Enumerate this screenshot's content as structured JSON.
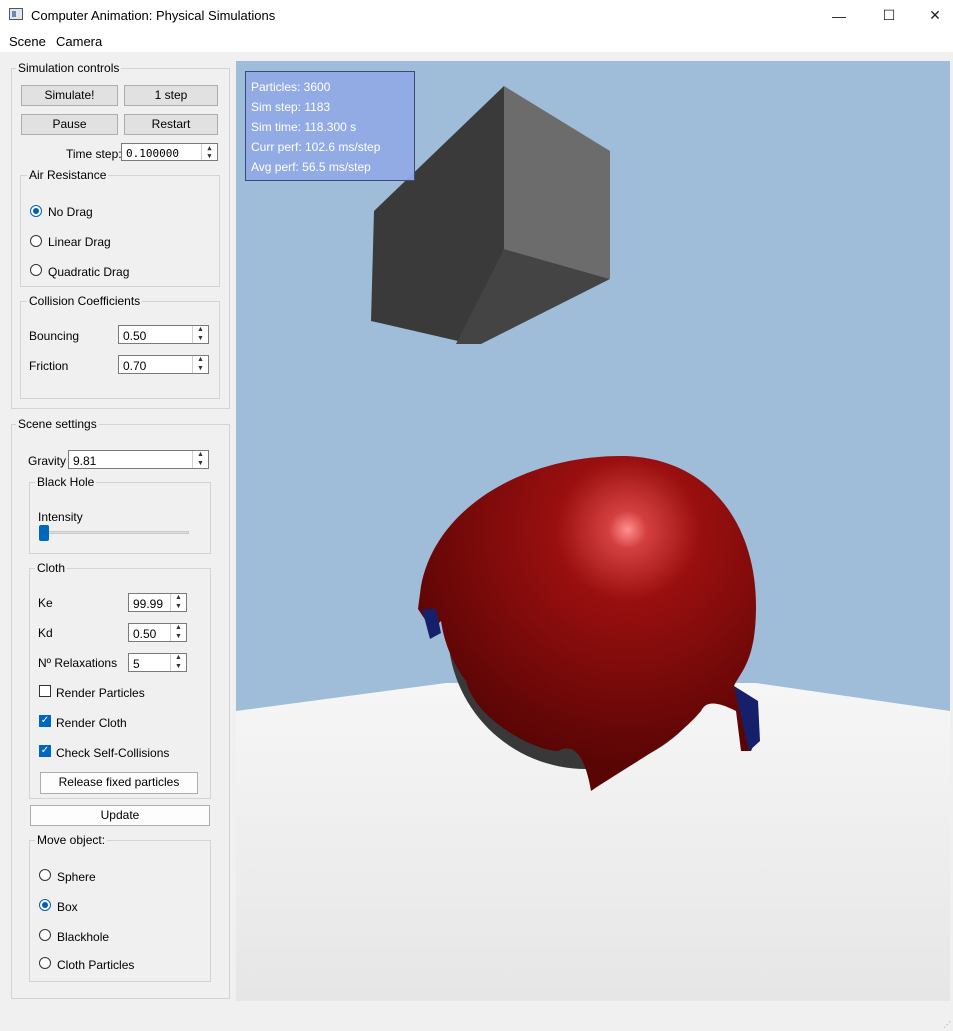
{
  "window": {
    "title": "Computer Animation: Physical Simulations",
    "minimize_glyph": "—",
    "maximize_glyph": "☐",
    "close_glyph": "✕"
  },
  "menu": [
    "Scene",
    "Camera"
  ],
  "sim_controls": {
    "title": "Simulation controls",
    "simulate_label": "Simulate!",
    "step_label": "1 step",
    "pause_label": "Pause",
    "restart_label": "Restart",
    "timestep_label": "Time step:",
    "timestep_value": "0.100000",
    "air": {
      "title": "Air Resistance",
      "options": [
        "No Drag",
        "Linear Drag",
        "Quadratic Drag"
      ],
      "selected": 0
    },
    "collision": {
      "title": "Collision Coefficients",
      "bouncing_label": "Bouncing",
      "bouncing_value": "0.50",
      "friction_label": "Friction",
      "friction_value": "0.70"
    }
  },
  "scene_settings": {
    "title": "Scene settings",
    "gravity_label": "Gravity",
    "gravity_value": "9.81",
    "black_hole": {
      "title": "Black Hole",
      "intensity_label": "Intensity",
      "intensity_level": 0
    },
    "cloth": {
      "title": "Cloth",
      "ke_label": "Ke",
      "ke_value": "99.99",
      "kd_label": "Kd",
      "kd_value": "0.50",
      "relax_label": "Nº Relaxations",
      "relax_value": "5",
      "render_particles_label": "Render Particles",
      "render_particles_checked": false,
      "render_cloth_label": "Render Cloth",
      "render_cloth_checked": true,
      "self_collisions_label": "Check Self-Collisions",
      "self_collisions_checked": true,
      "release_label": "Release fixed particles"
    },
    "update_label": "Update",
    "move_object": {
      "title": "Move object:",
      "options": [
        "Sphere",
        "Box",
        "Blackhole",
        "Cloth Particles"
      ],
      "selected": 1
    }
  },
  "stats": {
    "particles": "Particles: 3600",
    "sim_step": "Sim step:  1183",
    "sim_time": "Sim time:  118.300 s",
    "curr_perf": "Curr perf: 102.6 ms/step",
    "avg_perf": "Avg perf:  56.5 ms/step"
  },
  "colors": {
    "sky": "#9fbdd9",
    "floor": "#ececec",
    "cloth": "#8b0a0a",
    "box_dark": "#3a3a3a",
    "box_light": "#6c6c6c",
    "sphere": "#383838",
    "accent": "#005fb8"
  }
}
